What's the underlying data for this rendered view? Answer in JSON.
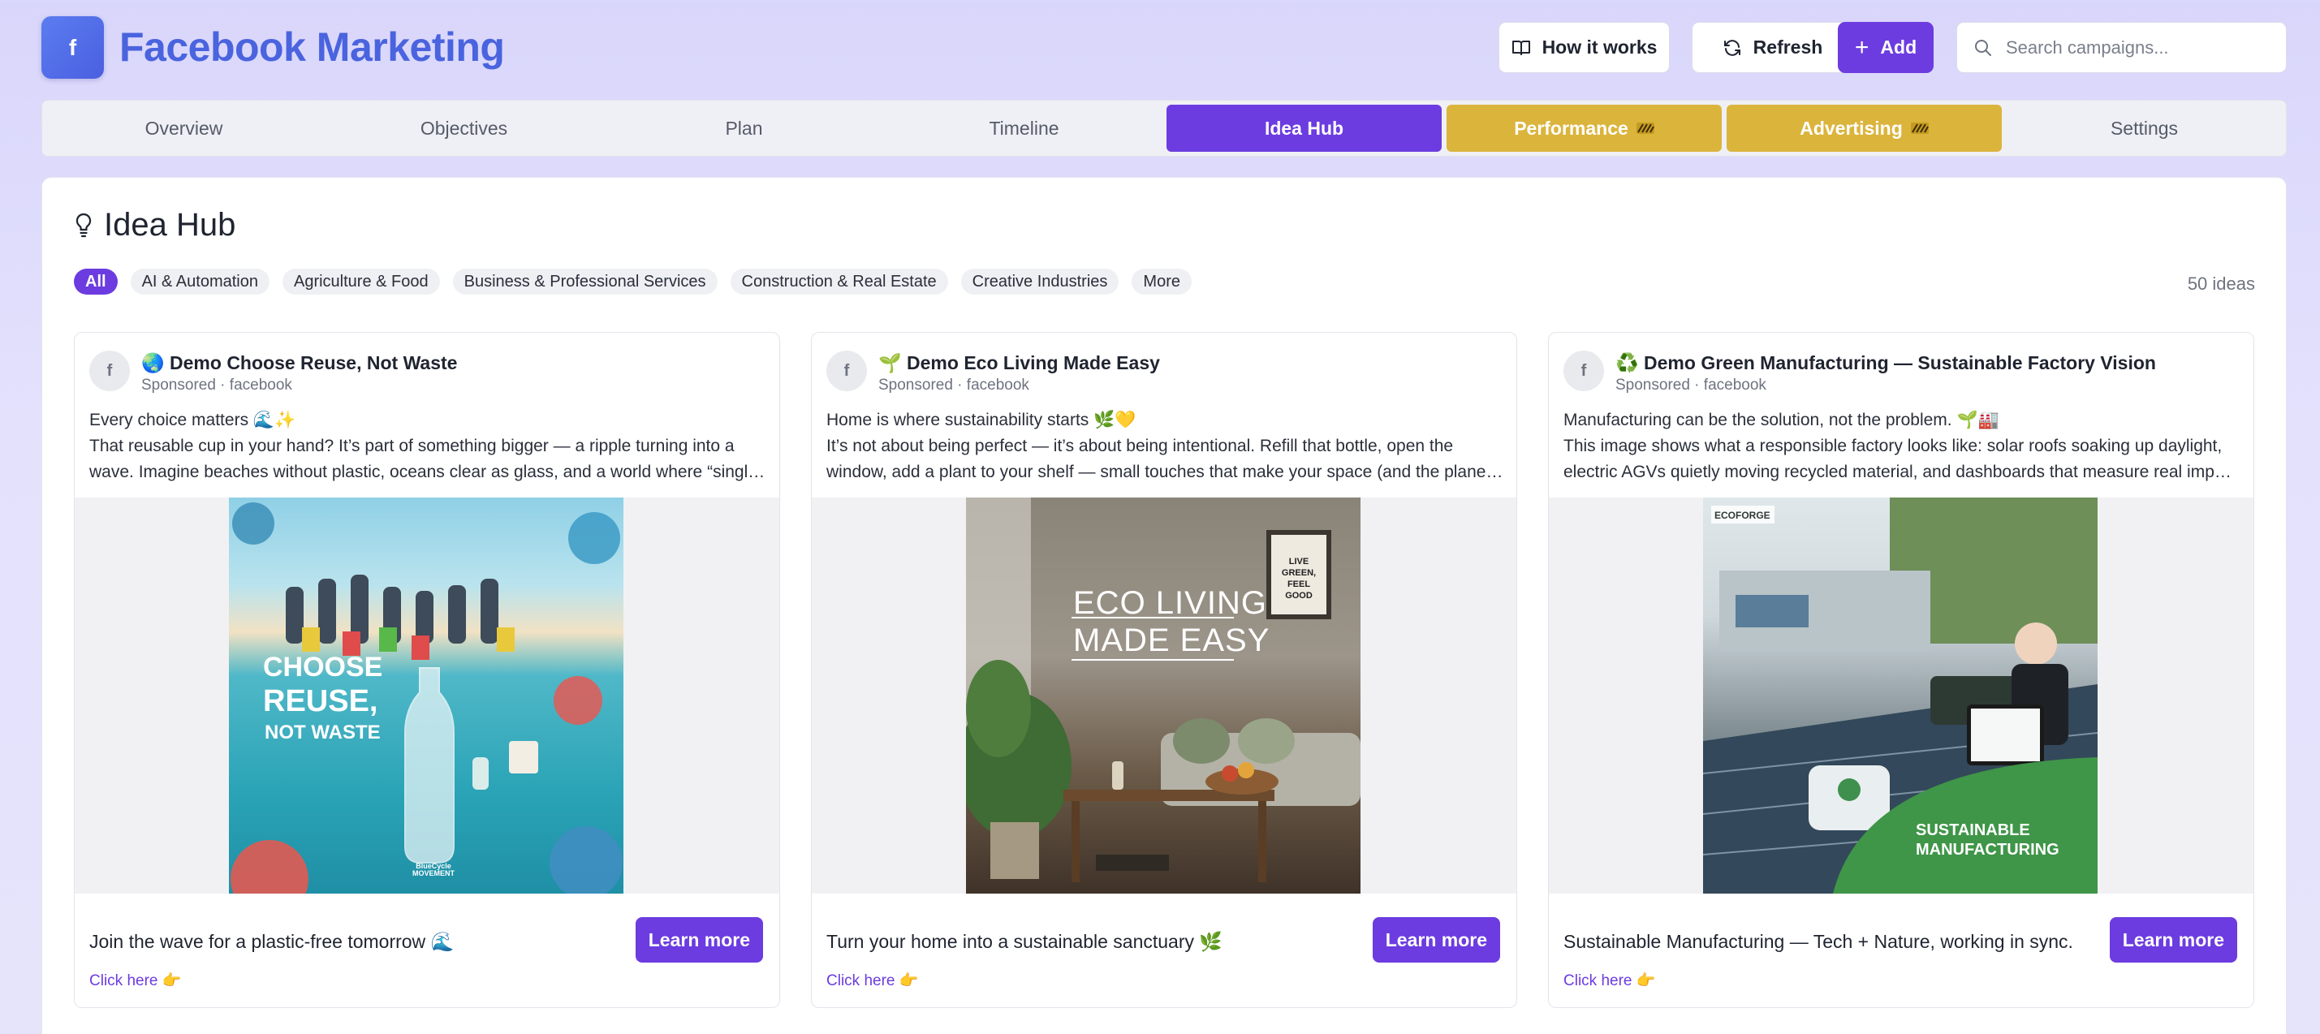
{
  "app": {
    "title": "Facebook Marketing",
    "logo_glyph": "f"
  },
  "header": {
    "how_label": "How it works",
    "refresh_label": "Refresh",
    "add_label": "Add",
    "search_placeholder": "Search campaigns..."
  },
  "tabs": [
    {
      "label": "Overview",
      "state": "normal"
    },
    {
      "label": "Objectives",
      "state": "normal"
    },
    {
      "label": "Plan",
      "state": "normal"
    },
    {
      "label": "Timeline",
      "state": "normal"
    },
    {
      "label": "Idea Hub",
      "state": "active"
    },
    {
      "label": "Performance",
      "state": "gold",
      "icon": "striped-badge-icon"
    },
    {
      "label": "Advertising",
      "state": "gold",
      "icon": "striped-badge-icon"
    },
    {
      "label": "Settings",
      "state": "normal"
    }
  ],
  "panel": {
    "title": "Idea Hub",
    "count": "50 ideas",
    "chips": [
      "All",
      "AI & Automation",
      "Agriculture & Food",
      "Business & Professional Services",
      "Construction & Real Estate",
      "Creative Industries",
      "More"
    ]
  },
  "cards": [
    {
      "title": "🌏 Demo Choose Reuse, Not Waste",
      "sub": "Sponsored · facebook",
      "line1": "Every choice matters 🌊✨",
      "line2": "That reusable cup in your hand? It’s part of something bigger — a ripple turning into a",
      "line3": "wave. Imagine beaches without plastic, oceans clear as glass, and a world where “single-...",
      "image_text": [
        "CHOOSE",
        "REUSE,",
        "NOT WASTE"
      ],
      "image_small": "BlueCycle MOVEMENT",
      "cta": "Join the wave for a plastic-free tomorrow 🌊",
      "button": "Learn more",
      "link": "Click here 👉"
    },
    {
      "title": "🌱 Demo Eco Living Made Easy",
      "sub": "Sponsored · facebook",
      "line1": "Home is where sustainability starts 🌿💛",
      "line2": "It’s not about being perfect — it’s about being intentional. Refill that bottle, open the",
      "line3": "window, add a plant to your shelf — small touches that make your space (and the planet...",
      "image_text": [
        "ECO LIVING",
        "MADE EASY"
      ],
      "image_small": "LIVE GREEN, FEEL GOOD",
      "cta": "Turn your home into a sustainable sanctuary 🌿",
      "button": "Learn more",
      "link": "Click here 👉"
    },
    {
      "title": "♻️ Demo Green Manufacturing — Sustainable Factory Vision",
      "sub": "Sponsored · facebook",
      "line1": "Manufacturing can be the solution, not the problem. 🌱🏭",
      "line2": "This image shows what a responsible factory looks like: solar roofs soaking up daylight,",
      "line3": "electric AGVs quietly moving recycled material, and dashboards that measure real impact...",
      "image_text": [
        "SUSTAINABLE",
        "MANUFACTURING"
      ],
      "image_small": "ECOFORGE",
      "cta": "Sustainable Manufacturing — Tech + Nature, working in sync.",
      "button": "Learn more",
      "link": "Click here 👉"
    }
  ],
  "colors": {
    "accent": "#6c3ce0",
    "brand_blue": "#4a63de",
    "gold": "#dbb43c"
  }
}
